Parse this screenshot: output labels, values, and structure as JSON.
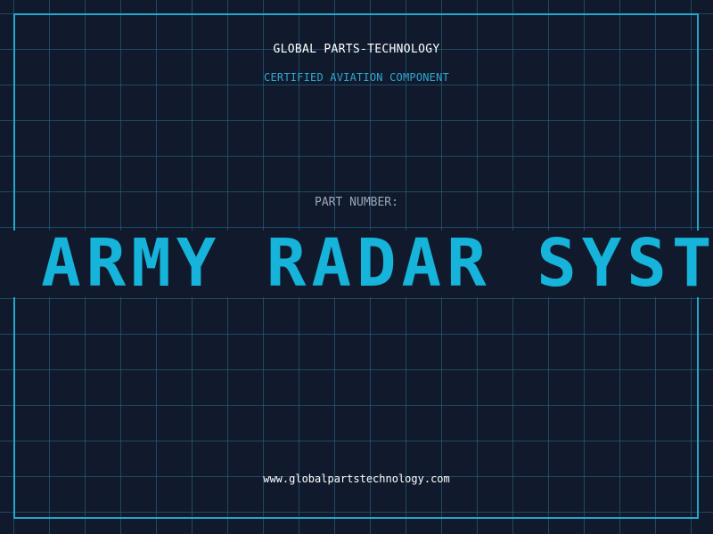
{
  "header": {
    "company": "GLOBAL PARTS-TECHNOLOGY",
    "subtitle": "CERTIFIED AVIATION COMPONENT"
  },
  "part": {
    "label": "PART NUMBER:",
    "value": "US ARMY RADAR SYSTEM"
  },
  "footer": {
    "url": "www.globalpartstechnology.com"
  },
  "colors": {
    "background": "#111a2c",
    "grid": "#286e8c",
    "accent": "#16b4da",
    "border": "#22a6c9"
  }
}
